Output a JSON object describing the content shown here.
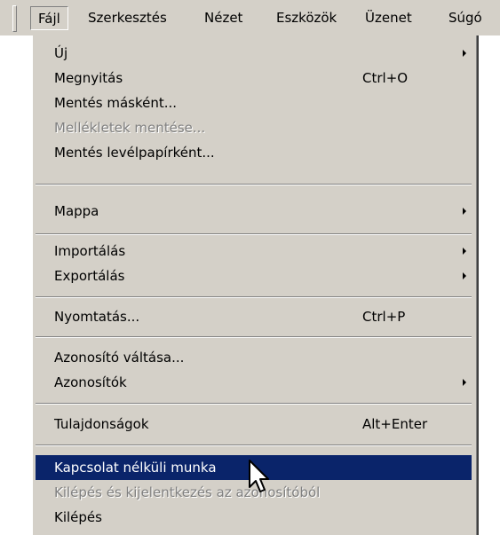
{
  "menubar": {
    "items": [
      {
        "label": "Fájl"
      },
      {
        "label": "Szerkesztés"
      },
      {
        "label": "Nézet"
      },
      {
        "label": "Eszközök"
      },
      {
        "label": "Üzenet"
      },
      {
        "label": "Súgó"
      }
    ]
  },
  "file_menu": {
    "items": [
      {
        "label": "Új",
        "submenu": true
      },
      {
        "label": "Megnyitás",
        "shortcut": "Ctrl+O"
      },
      {
        "label": "Mentés másként..."
      },
      {
        "label": "Mellékletek mentése...",
        "disabled": true
      },
      {
        "label": "Mentés levélpapírként..."
      },
      {
        "label": "Mappa",
        "submenu": true
      },
      {
        "label": "Importálás",
        "submenu": true
      },
      {
        "label": "Exportálás",
        "submenu": true
      },
      {
        "label": "Nyomtatás...",
        "shortcut": "Ctrl+P"
      },
      {
        "label": "Azonosító váltása..."
      },
      {
        "label": "Azonosítók",
        "submenu": true
      },
      {
        "label": "Tulajdonságok",
        "shortcut": "Alt+Enter"
      },
      {
        "label": "Kapcsolat nélküli munka",
        "highlighted": true
      },
      {
        "label": "Kilépés és kijelentkezés az azonosítóból",
        "disabled": true
      },
      {
        "label": "Kilépés"
      }
    ]
  },
  "colors": {
    "menu_background": "#d4d0c8",
    "highlight": "#0a246a",
    "disabled_text": "#808080"
  },
  "icons": [
    "submenu-arrow-icon",
    "mouse-pointer-icon"
  ]
}
